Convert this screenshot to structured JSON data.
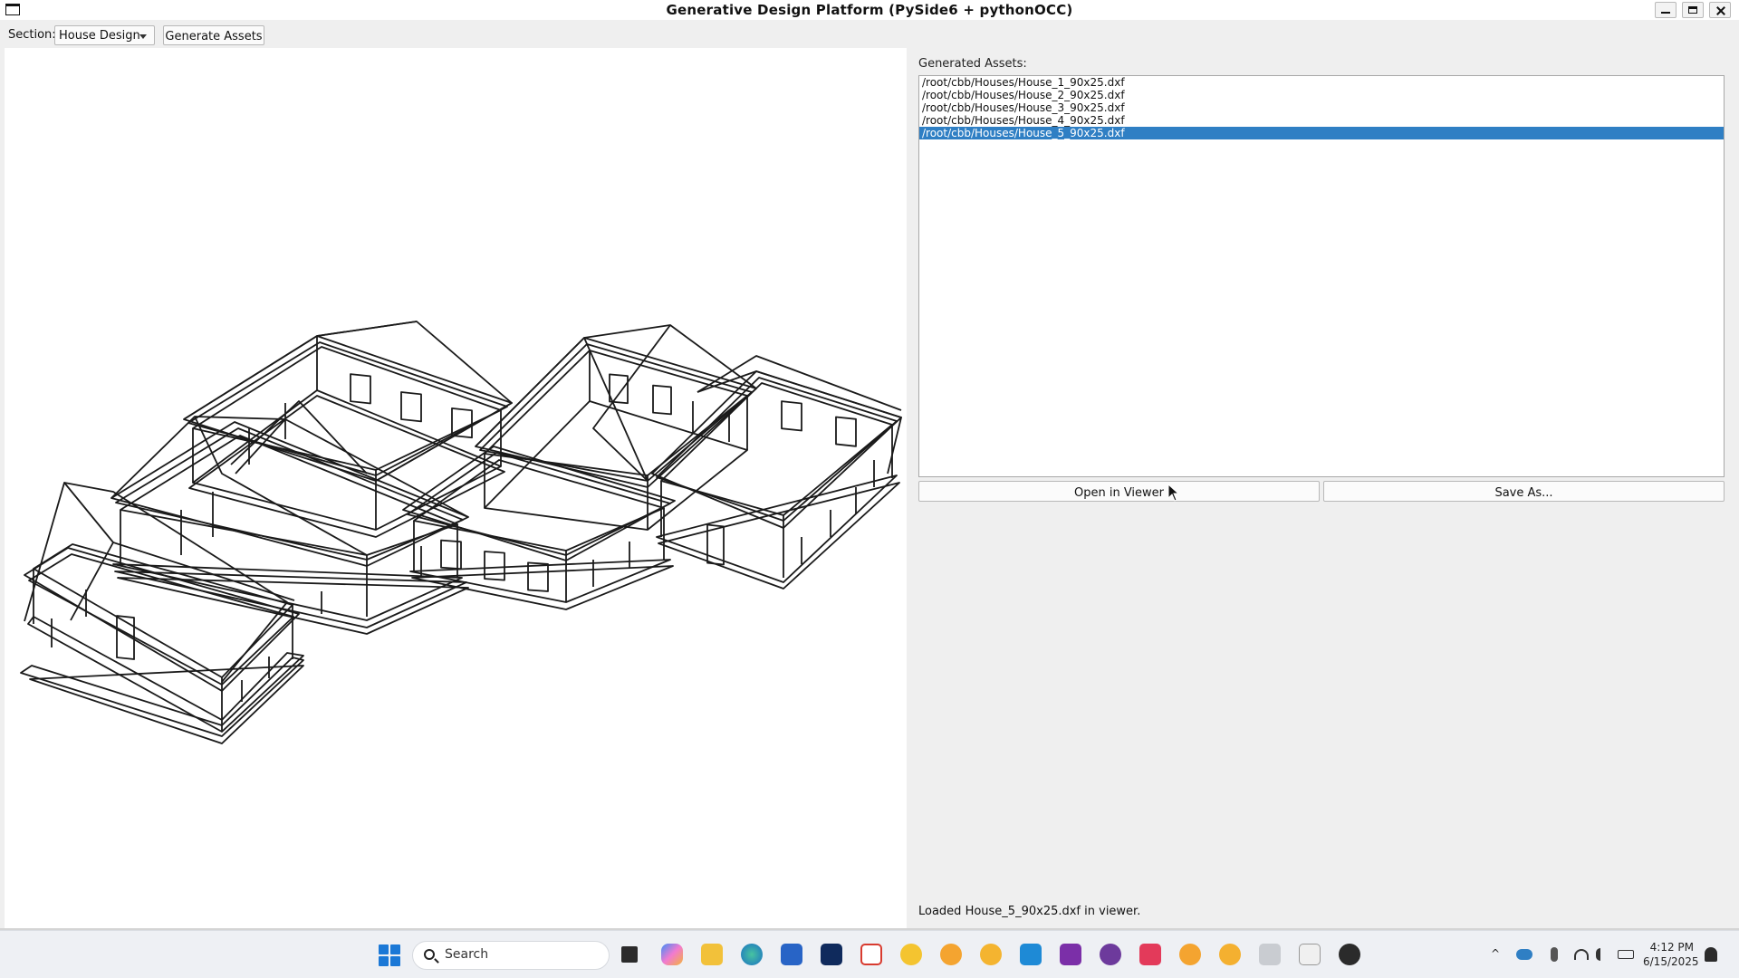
{
  "window": {
    "title": "Generative Design Platform (PySide6 + pythonOCC)"
  },
  "toolbar": {
    "section_label": "Section:",
    "section_value": "House Design",
    "generate_label": "Generate Assets"
  },
  "assets": {
    "header": "Generated Assets:",
    "items": [
      "/root/cbb/Houses/House_1_90x25.dxf",
      "/root/cbb/Houses/House_2_90x25.dxf",
      "/root/cbb/Houses/House_3_90x25.dxf",
      "/root/cbb/Houses/House_4_90x25.dxf",
      "/root/cbb/Houses/House_5_90x25.dxf"
    ],
    "selected_index": 4,
    "open_label": "Open in Viewer",
    "save_label": "Save As...",
    "status": "Loaded House_5_90x25.dxf in viewer."
  },
  "taskbar": {
    "search_placeholder": "Search",
    "time": "4:12 PM",
    "date": "6/15/2025",
    "pinned_icons": [
      "task-view-icon",
      "copilot-icon",
      "file-explorer-icon",
      "edge-icon",
      "store-icon",
      "terminal-icon",
      "pdf-tool-icon",
      "chrome-icon",
      "chrome-icon",
      "chrome-icon",
      "vscode-icon",
      "onenote-icon",
      "github-icon",
      "app-icon",
      "chrome-icon",
      "chrome-icon",
      "window-app-icon",
      "linux-icon",
      "obs-icon"
    ]
  }
}
